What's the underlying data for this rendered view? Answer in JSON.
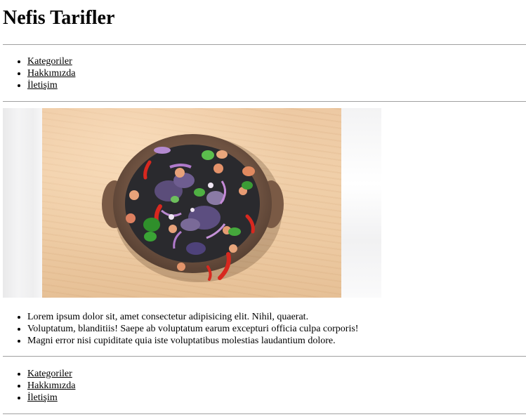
{
  "site": {
    "title": "Nefis Tarifler"
  },
  "nav": {
    "items": [
      {
        "label": "Kategoriler"
      },
      {
        "label": "Hakkımızda"
      },
      {
        "label": "İletişim"
      }
    ]
  },
  "hero": {
    "subject": "salad bowl on a wooden board"
  },
  "content": {
    "items": [
      "Lorem ipsum dolor sit, amet consectetur adipisicing elit. Nihil, quaerat.",
      "Voluptatum, blanditiis! Saepe ab voluptatum earum excepturi officia culpa corporis!",
      "Magni error nisi cupiditate quia iste voluptatibus molestias laudantium dolore."
    ]
  },
  "footer_nav": {
    "items": [
      {
        "label": "Kategoriler"
      },
      {
        "label": "Hakkımızda"
      },
      {
        "label": "İletişim"
      }
    ]
  },
  "colors": {
    "rule": "#a0a0a0",
    "text": "#000000",
    "background": "#ffffff"
  }
}
